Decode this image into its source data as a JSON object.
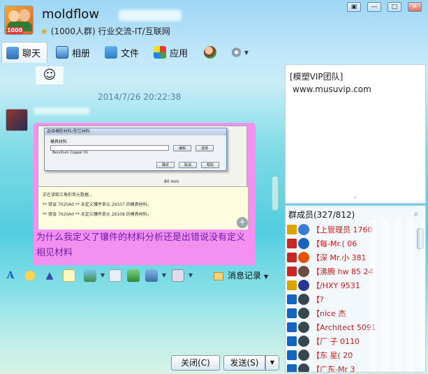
{
  "header": {
    "title": "moldflow",
    "subtitle": "(1000人群) 行业交流-IT/互联网",
    "avatar_badge": "1000"
  },
  "window_controls": [
    "▣",
    "—",
    "□",
    "✕"
  ],
  "tabs": [
    {
      "label": "聊天",
      "icon": "chat-icon",
      "active": true
    },
    {
      "label": "相册",
      "icon": "album-icon",
      "active": false
    },
    {
      "label": "文件",
      "icon": "folder-icon",
      "active": false
    },
    {
      "label": "应用",
      "icon": "apps-icon",
      "active": false
    }
  ],
  "chat": {
    "timestamp": "2014/7/26 20:22:38",
    "message_text": "为什么我定义了镶件的材料分析还是出错说没有定义相见材料",
    "screenshot": {
      "dialog_title": "选择模腔材料/型芯材料",
      "dialog_field_label": "模具材料",
      "dialog_field_value": "Beryllium Copper 01",
      "dialog_btn_edit": "编辑",
      "dialog_btn_select": "选择",
      "dialog_btn_ok": "确定",
      "dialog_btn_cancel": "取消",
      "dialog_btn_help": "帮助",
      "scale_label": "80 mm",
      "log_lines": [
        "正在读取三角形单元数据...",
        "** 错误 7020A0 ** 未定义镶件单元 29107 的模具材料。",
        "** 错误 7020A0 ** 未定义镶件单元 29108 的模具材料。"
      ]
    }
  },
  "format_toolbar": {
    "message_record_label": "消息记录"
  },
  "bottom": {
    "close_label": "关闭(C)",
    "send_label": "发送(S)"
  },
  "announcement": {
    "heading": "[模塑VIP团队]",
    "url": "www.musuvip.com"
  },
  "members": {
    "header": "群成员(327/812)",
    "rows": [
      {
        "tag": "【上",
        "name": "管理员 1760",
        "color1": "#d9a400",
        "color2": "#3a7bd5"
      },
      {
        "tag": "【",
        "name": "每-Mr.( 06",
        "color1": "#c62828",
        "color2": "#1565c0"
      },
      {
        "tag": "【",
        "name": "深 Mr.小 381",
        "color1": "#c62828",
        "color2": "#e65100"
      },
      {
        "tag": "【",
        "name": "沸腾 hw 85 24",
        "color1": "#c62828",
        "color2": "#6d4c41"
      },
      {
        "tag": "【",
        "name": "/HXY 9531",
        "color1": "#d9a400",
        "color2": "#283593"
      },
      {
        "tag": "【",
        "name": "?",
        "color1": "#1565c0",
        "color2": "#37474f"
      },
      {
        "tag": "【",
        "name": "nice 杰",
        "color1": "#1565c0",
        "color2": "#37474f"
      },
      {
        "tag": "【",
        "name": "Architect 5091",
        "color1": "#1565c0",
        "color2": "#37474f"
      },
      {
        "tag": "【",
        "name": "厂 子 0110",
        "color1": "#1565c0",
        "color2": "#37474f"
      },
      {
        "tag": "【",
        "name": "东 星( 20",
        "color1": "#1565c0",
        "color2": "#37474f"
      },
      {
        "tag": "【",
        "name": "广东-Mr 3",
        "color1": "#1565c0",
        "color2": "#37474f"
      }
    ]
  }
}
